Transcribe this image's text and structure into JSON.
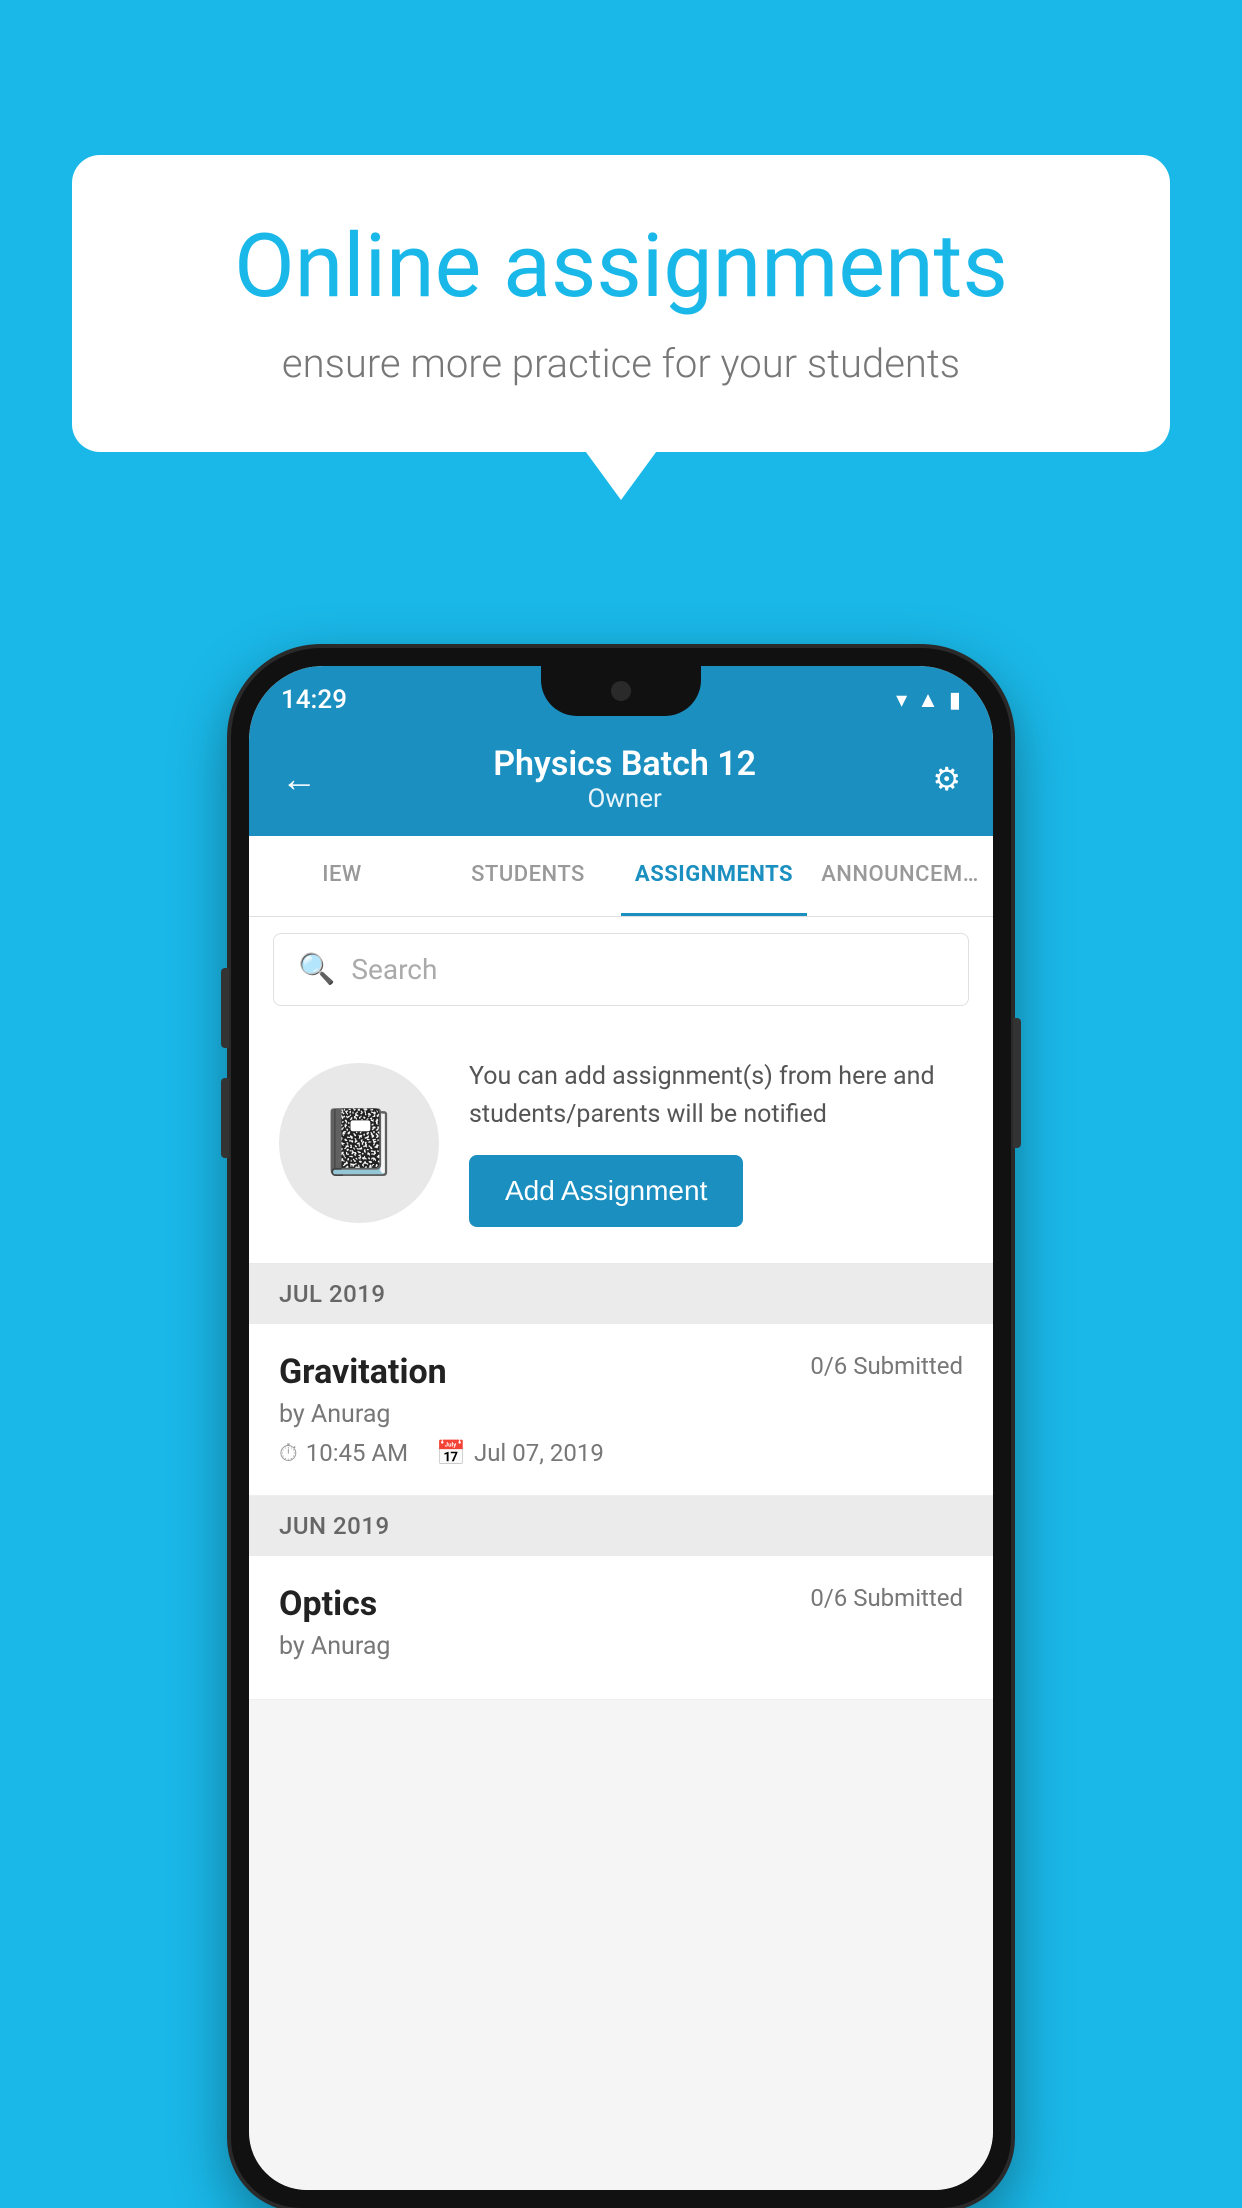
{
  "background": {
    "color": "#1ab8e8"
  },
  "speech_bubble": {
    "title": "Online assignments",
    "subtitle": "ensure more practice for your students"
  },
  "phone": {
    "status_bar": {
      "time": "14:29"
    },
    "header": {
      "back_label": "←",
      "title": "Physics Batch 12",
      "subtitle": "Owner",
      "settings_label": "⚙"
    },
    "tabs": [
      {
        "label": "IEW",
        "active": false
      },
      {
        "label": "STUDENTS",
        "active": false
      },
      {
        "label": "ASSIGNMENTS",
        "active": true
      },
      {
        "label": "ANNOUNCEM…",
        "active": false
      }
    ],
    "search": {
      "placeholder": "Search"
    },
    "promo": {
      "description": "You can add assignment(s) from here and students/parents will be notified",
      "button_label": "Add Assignment"
    },
    "sections": [
      {
        "header": "JUL 2019",
        "assignments": [
          {
            "title": "Gravitation",
            "submitted": "0/6 Submitted",
            "by": "by Anurag",
            "time": "10:45 AM",
            "date": "Jul 07, 2019"
          }
        ]
      },
      {
        "header": "JUN 2019",
        "assignments": [
          {
            "title": "Optics",
            "submitted": "0/6 Submitted",
            "by": "by Anurag",
            "time": "",
            "date": ""
          }
        ]
      }
    ]
  }
}
